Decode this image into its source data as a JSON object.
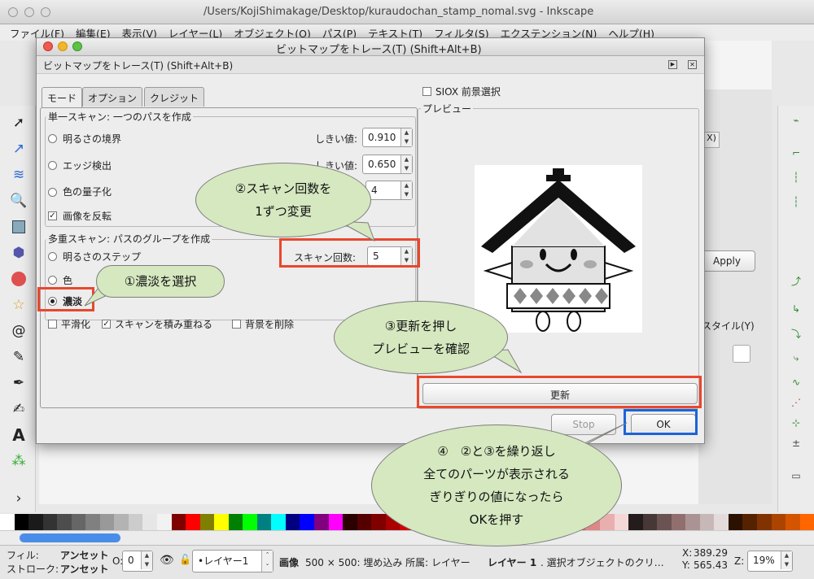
{
  "window": {
    "title": "/Users/KojiShimakage/Desktop/kuraudochan_stamp_nomal.svg - Inkscape"
  },
  "menu": [
    "ファイル(F)",
    "編集(E)",
    "表示(V)",
    "レイヤー(L)",
    "オブジェクト(O)",
    "パス(P)",
    "テキスト(T)",
    "フィルタ(S)",
    "エクステンション(N)",
    "ヘルプ(H)"
  ],
  "dialog": {
    "title": "ビットマップをトレース(T) (Shift+Alt+B)",
    "subtitle": "ビットマップをトレース(T) (Shift+Alt+B)",
    "tabs": [
      "モード",
      "オプション",
      "クレジット"
    ],
    "single_scan": {
      "label": "単一スキャン: 一つのパスを作成",
      "brightness": "明るさの境界",
      "edge": "エッジ検出",
      "quant": "色の量子化",
      "threshold_label": "しきい値:",
      "brightness_value": "0.910",
      "edge_value": "0.650",
      "quant_value": "4",
      "invert": "画像を反転"
    },
    "multi_scan": {
      "label": "多重スキャン: パスのグループを作成",
      "brightness_steps": "明るさのステップ",
      "colors": "色",
      "grays": "濃淡",
      "scans_label": "スキャン回数:",
      "scans_value": "5",
      "smooth": "平滑化",
      "stack": "スキャンを積み重ねる",
      "remove_bg": "背景を削除"
    },
    "siox": "SIOX 前景選択",
    "preview_label": "プレビュー",
    "update_button": "更新",
    "stop_button": "Stop",
    "ok_button": "OK"
  },
  "right_panel": {
    "apply": "Apply",
    "style_tab": "スタイル(Y)",
    "x_tab": "X)"
  },
  "callouts": {
    "c1": "①濃淡を選択",
    "c2": "②スキャン回数を\n1ずつ変更",
    "c3": "③更新を押し\nプレビューを確認",
    "c4": "④　②と③を繰り返し\n全てのパーツが表示される\nぎりぎりの値になったら\nOKを押す"
  },
  "status": {
    "fill_label": "フィル:",
    "fill_value": "アンセット",
    "stroke_label": "ストローク:",
    "stroke_value": "アンセット",
    "opacity_label": "O:",
    "opacity_value": "0",
    "layer": "•レイヤー1",
    "message_bold": "画像",
    "message": "500 × 500: 埋め込み 所属: レイヤー",
    "message_layer": "レイヤー 1",
    "message_tail": ". 選択オブジェクトのクリ…",
    "x_label": "X:",
    "x_value": "389.29",
    "y_label": "Y:",
    "y_value": "565.43",
    "zoom_label": "Z:",
    "zoom_value": "19%"
  },
  "colors": {
    "accent_red": "#e8472e",
    "accent_blue": "#1a64d8",
    "callout_fill": "#d5e8c0"
  }
}
